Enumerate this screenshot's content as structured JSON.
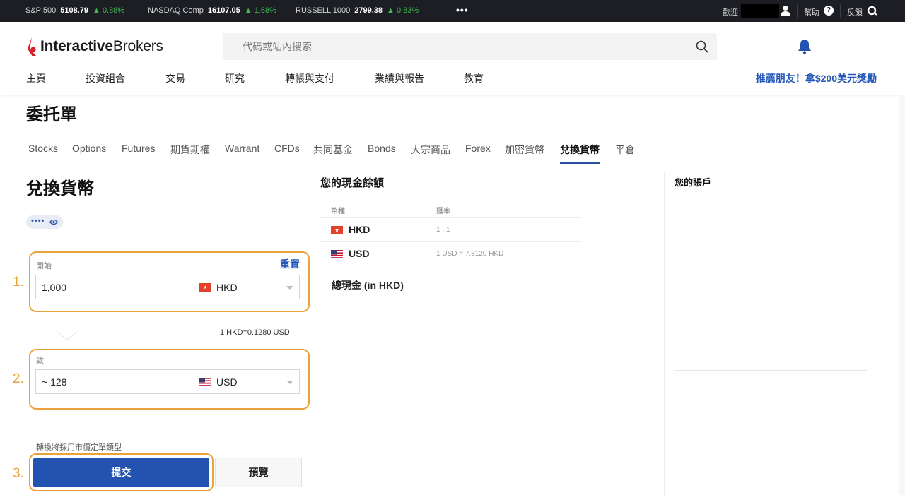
{
  "ticker": {
    "items": [
      {
        "name": "S&P 500",
        "value": "5108.79",
        "change": "▲ 0.88%"
      },
      {
        "name": "NASDAQ Comp",
        "value": "16107.05",
        "change": "▲ 1.68%"
      },
      {
        "name": "RUSSELL 1000",
        "value": "2799.38",
        "change": "▲ 0.83%"
      }
    ],
    "more": "•••",
    "welcome": "歡迎",
    "help": "幫助",
    "help_icon": "?",
    "feedback": "反饋"
  },
  "header": {
    "logo_bold": "Interactive",
    "logo_light": "Brokers",
    "search_placeholder": "代碼或站內搜索",
    "nav": [
      "主頁",
      "投資組合",
      "交易",
      "研究",
      "轉帳與支付",
      "業績與報告",
      "教育"
    ],
    "promo": "推薦朋友！拿$200美元獎勵"
  },
  "page": {
    "title": "委托單",
    "tabs": [
      "Stocks",
      "Options",
      "Futures",
      "期貨期權",
      "Warrant",
      "CFDs",
      "共同基金",
      "Bonds",
      "大宗商品",
      "Forex",
      "加密貨幣",
      "兌換貨幣",
      "平倉"
    ],
    "active_tab": "兌換貨幣"
  },
  "form": {
    "title": "兌換貨幣",
    "account_masked": "••••",
    "from": {
      "step": "1.",
      "label": "開始",
      "reset": "重置",
      "amount": "1,000",
      "currency": "HKD"
    },
    "rate": "1 HKD=0.1280 USD",
    "to": {
      "step": "2.",
      "label": "致",
      "amount": "~ 128",
      "currency": "USD"
    },
    "order_note": "轉換將採用市價定單類型",
    "submit_step": "3.",
    "submit": "提交",
    "preview": "預覽"
  },
  "cash": {
    "title": "您的現金餘額",
    "headers": [
      "幣種",
      "匯率"
    ],
    "rows": [
      {
        "currency": "HKD",
        "rate": "1 : 1"
      },
      {
        "currency": "USD",
        "rate": "1 USD  =  7.8120 HKD"
      }
    ],
    "total_label": "總現金 (in HKD)"
  },
  "account": {
    "title": "您的賬戶"
  },
  "colors": {
    "accent": "#2452b0",
    "highlight": "#e9a33a",
    "ticker_up": "#3fb950"
  }
}
